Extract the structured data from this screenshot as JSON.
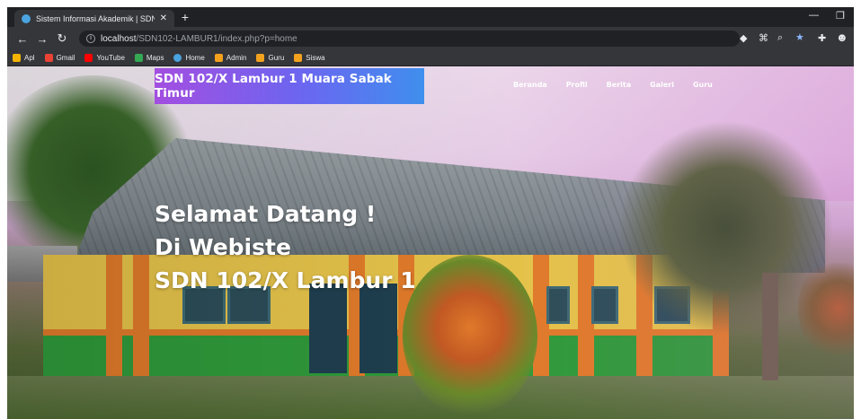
{
  "browser": {
    "tab_title": "Sistem Informasi Akademik | SDN",
    "new_tab": "+",
    "url_host": "localhost",
    "url_path": "/SDN102-LAMBUR1/index.php?p=home"
  },
  "bookmarks": [
    {
      "label": "Apl",
      "color": "#f4b400"
    },
    {
      "label": "Gmail",
      "color": "#ea4335"
    },
    {
      "label": "YouTube",
      "color": "#ff0000"
    },
    {
      "label": "Maps",
      "color": "#34a853"
    },
    {
      "label": "Home",
      "color": "#4aa3df"
    },
    {
      "label": "Admin",
      "color": "#f4a21e"
    },
    {
      "label": "Guru",
      "color": "#f4a21e"
    },
    {
      "label": "Siswa",
      "color": "#f4a21e"
    }
  ],
  "site": {
    "brand": "SDN 102/X Lambur 1 Muara Sabak Timur",
    "nav": [
      "Beranda",
      "Profil",
      "Berita",
      "Galeri",
      "Guru"
    ],
    "hero": [
      "Selamat Datang !",
      "Di Webiste",
      "SDN 102/X Lambur 1"
    ]
  }
}
